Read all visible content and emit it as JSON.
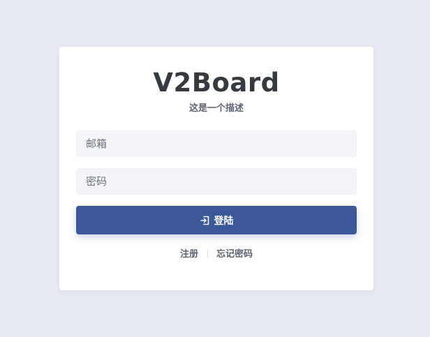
{
  "login": {
    "brand": "V2Board",
    "description": "这是一个描述",
    "email_placeholder": "邮箱",
    "password_placeholder": "密码",
    "submit_label": "登陆",
    "submit_icon": "sign-in-icon",
    "register_link": "注册",
    "forgot_link": "忘记密码"
  },
  "colors": {
    "background": "#e6e9f1",
    "card": "#ffffff",
    "primary": "#3b5998",
    "input_bg": "#f4f5f9"
  }
}
